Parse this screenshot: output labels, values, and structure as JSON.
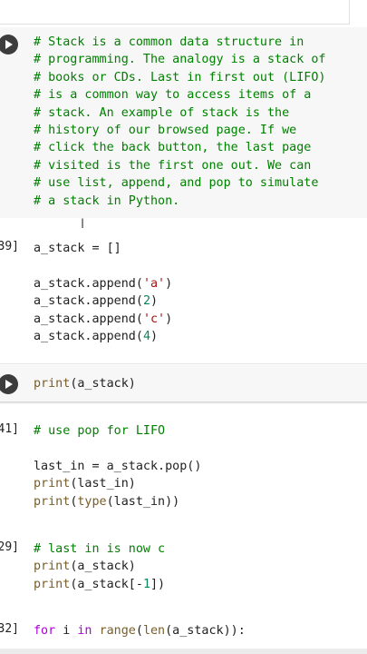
{
  "cells": [
    {
      "exec": "",
      "lines": [
        "# Stack is a common data structure in",
        "# programming. The analogy is a stack of",
        "# books or CDs. Last in first out (LIFO)",
        "# is a common way to access items of a",
        "# stack. An example of stack is the",
        "# history of our browsed page. If we",
        "# click the back button, the last page",
        "# visited is the first one out. We can",
        "# use list, append, and pop to simulate",
        "# a stack in Python."
      ]
    },
    {
      "exec": "39]",
      "lines": [
        "a_stack = []",
        "",
        "a_stack.append('a')",
        "a_stack.append(2)",
        "a_stack.append('c')",
        "a_stack.append(4)"
      ]
    },
    {
      "exec": "",
      "lines": [
        "print(a_stack)"
      ]
    },
    {
      "exec": "41]",
      "lines": [
        "# use pop for LIFO",
        "",
        "last_in = a_stack.pop()",
        "print(last_in)",
        "print(type(last_in))"
      ]
    },
    {
      "exec": "29]",
      "lines": [
        "# last in is now c",
        "print(a_stack)",
        "print(a_stack[-1])"
      ]
    },
    {
      "exec": "32]",
      "lines": [
        "for i in range(len(a_stack)):"
      ]
    }
  ],
  "cursor_glyph": "I"
}
